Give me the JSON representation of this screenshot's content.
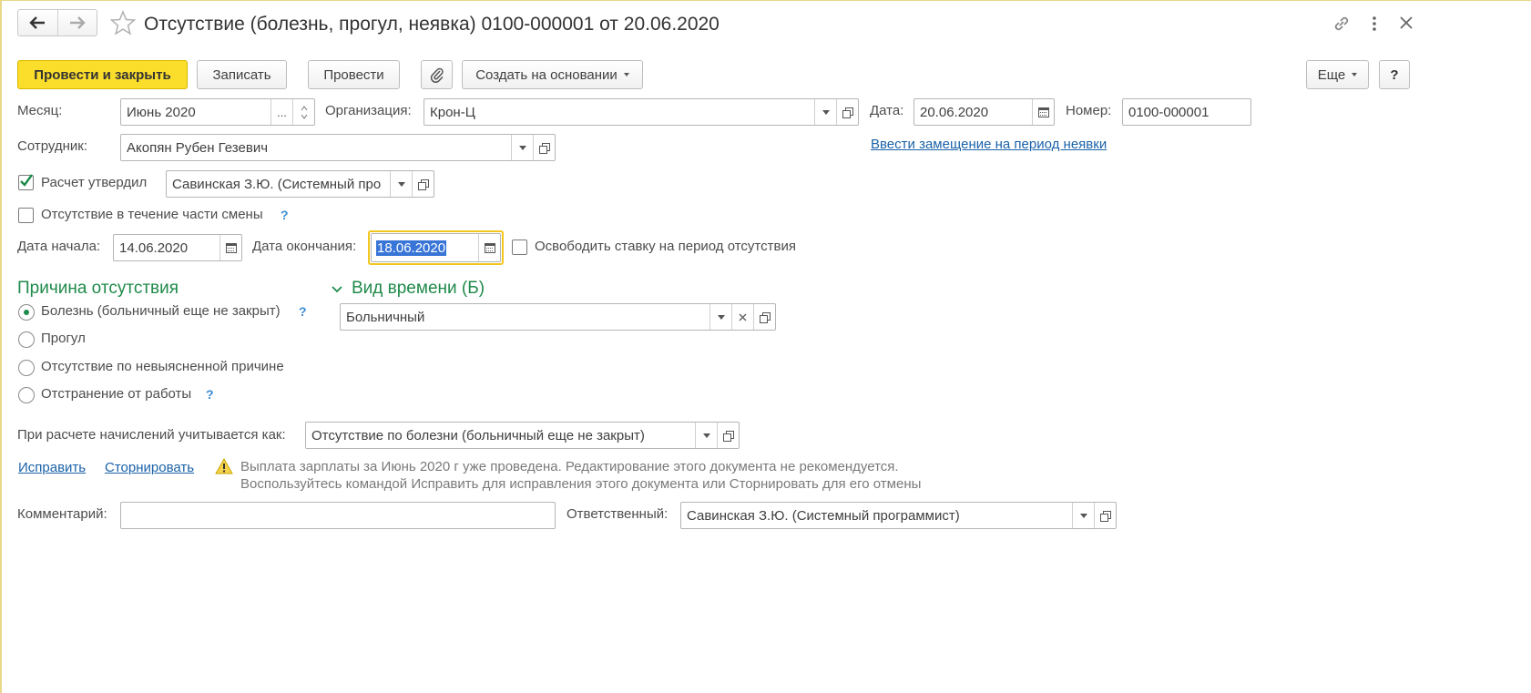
{
  "title": "Отсутствие (болезнь, прогул, неявка) 0100-000001 от 20.06.2020",
  "toolbar": {
    "post_and_close": "Провести и закрыть",
    "write": "Записать",
    "post": "Провести",
    "create_based_on": "Создать на основании",
    "more": "Еще",
    "help": "?"
  },
  "fields": {
    "month_label": "Месяц:",
    "month_value": "Июнь 2020",
    "month_dots": "...",
    "org_label": "Организация:",
    "org_value": "Крон-Ц",
    "date_label": "Дата:",
    "date_value": "20.06.2020",
    "number_label": "Номер:",
    "number_value": "0100-000001",
    "employee_label": "Сотрудник:",
    "employee_value": "Акопян Рубен Гезевич",
    "substitution_link": "Ввести замещение на период неявки",
    "approved_label": "Расчет утвердил",
    "approved_value": "Савинская З.Ю. (Системный про",
    "partial_shift_label": "Отсутствие в течение части смены",
    "start_label": "Дата начала:",
    "start_value": "14.06.2020",
    "end_label": "Дата окончания:",
    "end_value": "18.06.2020",
    "free_rate_label": "Освободить ставку на период отсутствия",
    "help_mark": "?"
  },
  "reason": {
    "header": "Причина отсутствия",
    "options": [
      "Болезнь (больничный еще не закрыт)",
      "Прогул",
      "Отсутствие по невыясненной причине",
      "Отстранение от работы"
    ]
  },
  "time_type": {
    "header": "Вид времени (Б)",
    "value": "Больничный"
  },
  "accrual": {
    "label": "При расчете начислений учитывается как:",
    "value": "Отсутствие по болезни (больничный еще не закрыт)"
  },
  "actions": {
    "fix": "Исправить",
    "reverse": "Сторнировать",
    "warning_line1": "Выплата зарплаты за Июнь 2020 г уже проведена. Редактирование этого документа не рекомендуется.",
    "warning_line2": "Воспользуйтесь командой Исправить для исправления этого документа или Сторнировать для его отмены"
  },
  "footer": {
    "comment_label": "Комментарий:",
    "comment_value": "",
    "responsible_label": "Ответственный:",
    "responsible_value": "Савинская З.Ю. (Системный программист)"
  },
  "colors": {
    "primary_button": "#fbdd2c",
    "section_green": "#1f8a4a",
    "link_blue": "#1b62a8",
    "focus_border": "#f2c61f",
    "selection": "#3875d7"
  }
}
